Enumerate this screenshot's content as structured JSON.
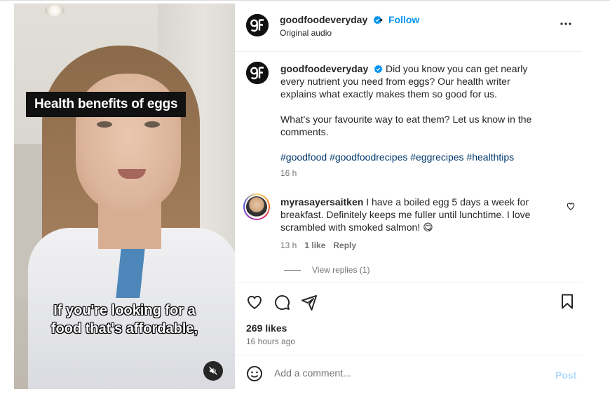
{
  "video": {
    "title_overlay": "Health benefits of eggs",
    "caption_line1": "If you're looking for a",
    "caption_line2": "food that's affordable,"
  },
  "header": {
    "username": "goodfoodeveryday",
    "separator": "•",
    "follow_label": "Follow",
    "audio_label": "Original audio",
    "logo_text": "gF"
  },
  "post": {
    "username": "goodfoodeveryday",
    "caption_p1": "Did you know you can get nearly every nutrient you need from eggs? Our health writer explains what exactly makes them so good for us.",
    "caption_p2": "What's your favourite way to eat them? Let us know in the comments.",
    "hashtags": "#goodfood #goodfoodrecipes #eggrecipes #healthtips",
    "time": "16 h"
  },
  "comment": {
    "username": "myrasayersaitken",
    "text": "I have a boiled egg 5 days a week for breakfast. Definitely keeps me fuller until lunchtime. I love scrambled with smoked salmon! 😋",
    "time": "13 h",
    "likes": "1 like",
    "reply_label": "Reply",
    "view_replies": "View replies (1)"
  },
  "engagement": {
    "likes": "269 likes",
    "posted": "16 hours ago"
  },
  "composer": {
    "placeholder": "Add a comment...",
    "post_label": "Post"
  },
  "colors": {
    "accent": "#0095f6",
    "verified": "#0095f6",
    "hashtag": "#00376b",
    "post_disabled": "#b3dbff"
  },
  "icons": [
    "verified-badge-icon",
    "more-options-icon",
    "heart-icon",
    "comment-icon",
    "share-icon",
    "bookmark-icon",
    "emoji-icon",
    "mute-icon"
  ]
}
